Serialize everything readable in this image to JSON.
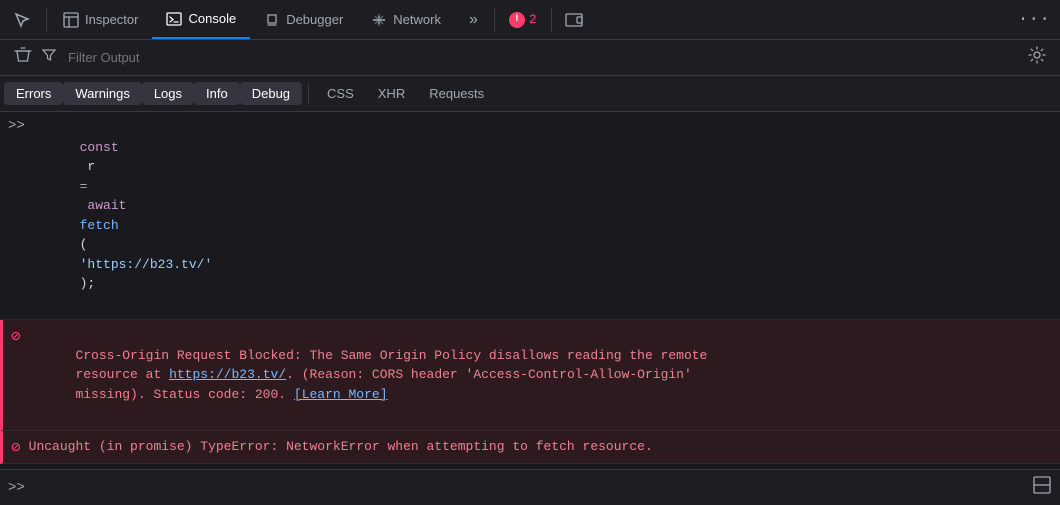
{
  "toolbar": {
    "picker_label": "",
    "inspector_label": "Inspector",
    "console_label": "Console",
    "debugger_label": "Debugger",
    "network_label": "Network",
    "more_icon": "»",
    "error_count": "2",
    "responsive_icon": "⬜",
    "more_options_icon": "···"
  },
  "filter_bar": {
    "placeholder": "Filter Output",
    "clear_icon": "🗑",
    "filter_icon": "⊼",
    "settings_icon": "⚙"
  },
  "filter_tabs": {
    "tabs": [
      {
        "id": "errors",
        "label": "Errors",
        "active": true
      },
      {
        "id": "warnings",
        "label": "Warnings",
        "active": true
      },
      {
        "id": "logs",
        "label": "Logs",
        "active": true
      },
      {
        "id": "info",
        "label": "Info",
        "active": true
      },
      {
        "id": "debug",
        "label": "Debug",
        "active": true
      }
    ],
    "plain_tabs": [
      {
        "id": "css",
        "label": "CSS"
      },
      {
        "id": "xhr",
        "label": "XHR"
      },
      {
        "id": "requests",
        "label": "Requests"
      }
    ]
  },
  "console": {
    "command": "const r = await fetch('https://b23.tv/');",
    "error1": "Cross-Origin Request Blocked: The Same Origin Policy disallows reading the remote resource at https://b23.tv/. (Reason: CORS header 'Access-Control-Allow-Origin' missing). Status code: 200.",
    "error1_link": "[Learn More]",
    "error1_url": "https://b23.tv/",
    "error2": "Uncaught (in promise) TypeError: NetworkError when attempting to fetch resource."
  },
  "bottom_bar": {
    "prompt": ">>",
    "split_icon": "⊟"
  }
}
